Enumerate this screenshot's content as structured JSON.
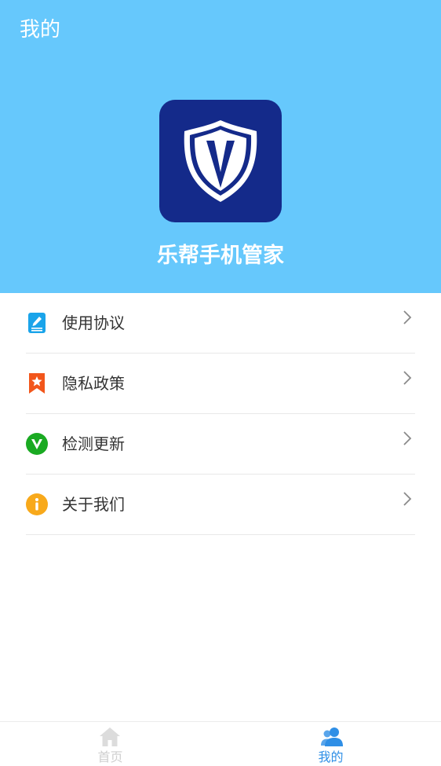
{
  "header": {
    "title": "我的",
    "app_name": "乐帮手机管家",
    "background_color": "#66c8fc",
    "logo_icon": "shield-v-icon"
  },
  "menu": {
    "items": [
      {
        "label": "使用协议",
        "icon": "document-edit-icon",
        "icon_color": "#1aa4ea"
      },
      {
        "label": "隐私政策",
        "icon": "bookmark-star-icon",
        "icon_color": "#f2561b"
      },
      {
        "label": "检测更新",
        "icon": "v-badge-icon",
        "icon_color": "#1aaa22"
      },
      {
        "label": "关于我们",
        "icon": "info-icon",
        "icon_color": "#f8a91b"
      }
    ]
  },
  "tabbar": {
    "tabs": [
      {
        "label": "首页",
        "icon": "home-icon",
        "active": false
      },
      {
        "label": "我的",
        "icon": "user-group-icon",
        "active": true
      }
    ],
    "active_color": "#2f8fe6",
    "inactive_color": "#cfcfcf"
  }
}
